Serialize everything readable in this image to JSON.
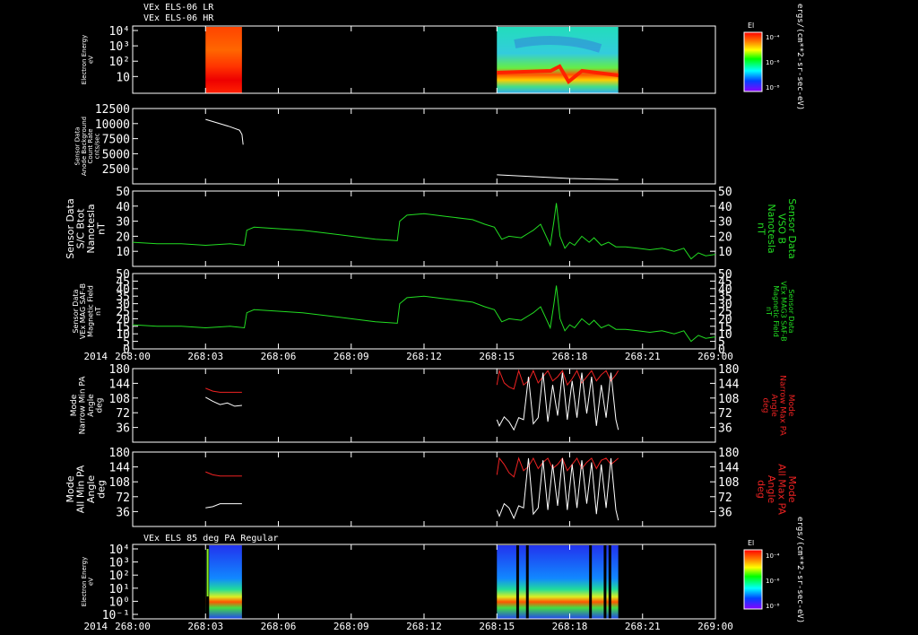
{
  "titles": {
    "top_line1": "VEx ELS-06 LR",
    "top_line2": "VEx ELS-06 HR",
    "bottom": "VEx ELS 85 deg PA Regular"
  },
  "time_axis": {
    "year_label": "2014",
    "ticks": [
      "268:00",
      "268:03",
      "268:06",
      "268:09",
      "268:12",
      "268:15",
      "268:18",
      "268:21",
      "269:00"
    ],
    "range_minutes": [
      0,
      24
    ]
  },
  "colors": {
    "trace_white": "#ffffff",
    "trace_green": "#22dd22",
    "trace_red": "#ee2222",
    "axis": "#ffffff",
    "background": "#000000"
  },
  "colorbars": {
    "top": {
      "title": "El",
      "ticks": [
        "10⁻⁴",
        "10⁻⁶",
        "10⁻⁸"
      ],
      "unit": "ergs/(cm**2-sr-sec-eV)"
    },
    "bottom": {
      "title": "El",
      "ticks": [
        "10⁻⁴",
        "10⁻⁶",
        "10⁻⁸"
      ],
      "unit": "ergs/(cm**2-sr-sec-eV)"
    }
  },
  "chart_data": [
    {
      "type": "heatmap",
      "ylabel": "Electron Energy\neV",
      "yscale": "log",
      "yticks": [
        "10⁴",
        "10³",
        "10²",
        "10"
      ],
      "ylim": [
        1,
        20000
      ],
      "blocks_minutes": [
        [
          3.0,
          4.5
        ],
        [
          15.0,
          20.0
        ]
      ],
      "colorscale": "rainbow"
    },
    {
      "type": "line",
      "ylabel": "Sensor Data\nAnode Background\nCount Rate\ncnts/sec",
      "ylim": [
        0,
        12500
      ],
      "yticks": [
        2500,
        5000,
        7500,
        10000,
        12500
      ],
      "series": [
        {
          "color": "#ffffff",
          "x": [
            3.0,
            3.5,
            4.0,
            4.4,
            4.5,
            4.55
          ],
          "y": [
            10700,
            10100,
            9500,
            8900,
            8200,
            6500
          ]
        },
        {
          "color": "#ffffff",
          "x": [
            15.0,
            16.0,
            17.0,
            18.0,
            19.0,
            20.0
          ],
          "y": [
            1500,
            1300,
            1100,
            900,
            800,
            700
          ]
        }
      ]
    },
    {
      "type": "line",
      "ylabel": "Sensor Data\nS/C Btot\nNanotesla\nnT",
      "ylabel_right": "Sensor Data\nVSO B\nNanotesla\nnT",
      "ylim": [
        0,
        50
      ],
      "yticks": [
        10,
        20,
        30,
        40,
        50
      ],
      "series": [
        {
          "color": "#22dd22",
          "x": [
            0,
            1,
            2,
            3,
            4,
            4.6,
            4.7,
            5,
            6,
            7,
            8,
            9,
            10,
            10.9,
            11,
            11.3,
            12,
            13,
            14,
            14.5,
            14.9,
            15.2,
            15.5,
            16,
            16.3,
            16.5,
            16.8,
            17.0,
            17.2,
            17.35,
            17.45,
            17.6,
            17.8,
            18.0,
            18.2,
            18.5,
            18.8,
            19.0,
            19.3,
            19.6,
            19.9,
            20.3,
            20.8,
            21.3,
            21.8,
            22.3,
            22.7,
            23.0,
            23.3,
            23.6,
            24.0
          ],
          "y": [
            16,
            15,
            15,
            14,
            15,
            14,
            24,
            26,
            25,
            24,
            22,
            20,
            18,
            17,
            30,
            34,
            35,
            33,
            31,
            28,
            26,
            18,
            20,
            19,
            22,
            24,
            28,
            21,
            14,
            30,
            42,
            20,
            12,
            16,
            14,
            20,
            16,
            19,
            14,
            16,
            13,
            13,
            12,
            11,
            12,
            10,
            12,
            5,
            9,
            7,
            8
          ]
        }
      ]
    },
    {
      "type": "line",
      "ylabel": "Sensor Data\nVEx MAG SAF-B\nMagnetic Field\nnT",
      "ylabel_right": "Sensor Data\nVEx MAG3 SAF-B\nMagnetic Field\nnT",
      "ylim": [
        0,
        50
      ],
      "yticks": [
        0,
        5,
        10,
        15,
        20,
        25,
        30,
        35,
        40,
        45,
        50
      ],
      "series": [
        {
          "color": "#22dd22",
          "x": [
            0,
            1,
            2,
            3,
            4,
            4.6,
            4.7,
            5,
            6,
            7,
            8,
            9,
            10,
            10.9,
            11,
            11.3,
            12,
            13,
            14,
            14.5,
            14.9,
            15.2,
            15.5,
            16,
            16.3,
            16.5,
            16.8,
            17.0,
            17.2,
            17.35,
            17.45,
            17.6,
            17.8,
            18.0,
            18.2,
            18.5,
            18.8,
            19.0,
            19.3,
            19.6,
            19.9,
            20.3,
            20.8,
            21.3,
            21.8,
            22.3,
            22.7,
            23.0,
            23.3,
            23.6,
            24.0
          ],
          "y": [
            16,
            15,
            15,
            14,
            15,
            14,
            24,
            26,
            25,
            24,
            22,
            20,
            18,
            17,
            30,
            34,
            35,
            33,
            31,
            28,
            26,
            18,
            20,
            19,
            22,
            24,
            28,
            21,
            14,
            30,
            42,
            20,
            12,
            16,
            14,
            20,
            16,
            19,
            14,
            16,
            13,
            13,
            12,
            11,
            12,
            10,
            12,
            5,
            9,
            7,
            8
          ]
        }
      ]
    },
    {
      "type": "line",
      "ylabel": "Mode\nNarrow Min PA\nAngle\ndeg",
      "ylabel_right": "Mode\nNarrow Max PA\nAngle\ndeg",
      "ylim": [
        0,
        180
      ],
      "yticks": [
        36,
        72,
        108,
        144,
        180
      ],
      "series": [
        {
          "color": "#ee2222",
          "x": [
            3.0,
            3.3,
            3.6,
            3.9,
            4.2,
            4.5
          ],
          "y": [
            132,
            125,
            122,
            122,
            122,
            122
          ]
        },
        {
          "color": "#ffffff",
          "x": [
            3.0,
            3.3,
            3.6,
            3.9,
            4.2,
            4.5
          ],
          "y": [
            110,
            100,
            92,
            96,
            88,
            90
          ]
        },
        {
          "color": "#ee2222",
          "x": [
            15.0,
            15.1,
            15.3,
            15.5,
            15.7,
            15.9,
            16.1,
            16.3,
            16.5,
            16.7,
            16.9,
            17.1,
            17.3,
            17.5,
            17.7,
            17.9,
            18.1,
            18.3,
            18.5,
            18.7,
            18.9,
            19.1,
            19.3,
            19.5,
            19.7,
            19.9,
            20.0
          ],
          "y": [
            140,
            175,
            145,
            135,
            130,
            175,
            140,
            150,
            175,
            145,
            160,
            175,
            150,
            160,
            175,
            140,
            155,
            175,
            145,
            160,
            175,
            150,
            165,
            175,
            150,
            165,
            175
          ]
        },
        {
          "color": "#ffffff",
          "x": [
            15.0,
            15.1,
            15.3,
            15.5,
            15.7,
            15.9,
            16.1,
            16.3,
            16.5,
            16.7,
            16.9,
            17.1,
            17.3,
            17.5,
            17.7,
            17.9,
            18.1,
            18.3,
            18.5,
            18.7,
            18.9,
            19.1,
            19.3,
            19.5,
            19.7,
            19.9,
            20.0
          ],
          "y": [
            55,
            40,
            62,
            50,
            30,
            60,
            55,
            160,
            45,
            60,
            170,
            50,
            140,
            65,
            170,
            55,
            150,
            60,
            170,
            70,
            160,
            40,
            140,
            60,
            170,
            55,
            30
          ]
        }
      ]
    },
    {
      "type": "line",
      "ylabel": "Mode\nAll Min PA\nAngle\ndeg",
      "ylabel_right": "Mode\nAll Max PA\nAngle\ndeg",
      "ylim": [
        0,
        180
      ],
      "yticks": [
        36,
        72,
        108,
        144,
        180
      ],
      "series": [
        {
          "color": "#ee2222",
          "x": [
            3.0,
            3.3,
            3.6,
            3.9,
            4.2,
            4.5
          ],
          "y": [
            132,
            125,
            122,
            122,
            122,
            122
          ]
        },
        {
          "color": "#ffffff",
          "x": [
            3.0,
            3.3,
            3.6,
            3.9,
            4.2,
            4.5
          ],
          "y": [
            45,
            48,
            55,
            55,
            55,
            55
          ]
        },
        {
          "color": "#ee2222",
          "x": [
            15.0,
            15.1,
            15.3,
            15.5,
            15.7,
            15.9,
            16.1,
            16.3,
            16.5,
            16.7,
            16.9,
            17.1,
            17.3,
            17.5,
            17.7,
            17.9,
            18.1,
            18.3,
            18.5,
            18.7,
            18.9,
            19.1,
            19.3,
            19.5,
            19.7,
            19.9,
            20.0
          ],
          "y": [
            125,
            165,
            150,
            130,
            120,
            165,
            135,
            145,
            165,
            140,
            155,
            165,
            140,
            150,
            165,
            135,
            150,
            165,
            140,
            155,
            165,
            140,
            160,
            165,
            150,
            160,
            165
          ]
        },
        {
          "color": "#ffffff",
          "x": [
            15.0,
            15.1,
            15.3,
            15.5,
            15.7,
            15.9,
            16.1,
            16.3,
            16.5,
            16.7,
            16.9,
            17.1,
            17.3,
            17.5,
            17.7,
            17.9,
            18.1,
            18.3,
            18.5,
            18.7,
            18.9,
            19.1,
            19.3,
            19.5,
            19.7,
            19.9,
            20.0
          ],
          "y": [
            40,
            25,
            55,
            45,
            20,
            50,
            45,
            165,
            30,
            45,
            160,
            40,
            150,
            50,
            165,
            40,
            150,
            45,
            160,
            55,
            155,
            30,
            150,
            45,
            165,
            40,
            15
          ]
        }
      ]
    },
    {
      "type": "heatmap",
      "ylabel": "Electron Energy\neV",
      "yscale": "log",
      "yticks": [
        "10⁴",
        "10³",
        "10²",
        "10¹",
        "10⁰",
        "10⁻¹"
      ],
      "ylim": [
        0.1,
        20000
      ],
      "blocks_minutes": [
        [
          3.0,
          4.5
        ],
        [
          15.0,
          20.0
        ]
      ],
      "colorscale": "rainbow"
    }
  ]
}
